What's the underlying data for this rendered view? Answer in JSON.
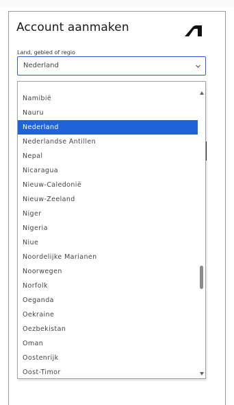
{
  "form": {
    "title": "Account aanmaken",
    "country_label": "Land, gebied of regio",
    "country_value": "Nederland"
  },
  "icons": {
    "brand_logo": "autodesk-logo",
    "select_chevron": "chevron-down-icon",
    "scroll_up": "scroll-up-arrow-icon",
    "scroll_down": "scroll-down-arrow-icon"
  },
  "dropdown": {
    "selected_index": 2,
    "options": [
      "Namibië",
      "Nauru",
      "Nederland",
      "Nederlandse Antillen",
      "Nepal",
      "Nicaragua",
      "Nieuw-Caledonië",
      "Nieuw-Zeeland",
      "Niger",
      "Nigeria",
      "Niue",
      "Noordelijke Marianen",
      "Noorwegen",
      "Norfolk",
      "Oeganda",
      "Oekraine",
      "Oezbekistan",
      "Oman",
      "Oostenrijk",
      "Oost-Timor"
    ]
  },
  "colors": {
    "accent": "#1e63d8",
    "focus_border": "#2a5bd7"
  }
}
